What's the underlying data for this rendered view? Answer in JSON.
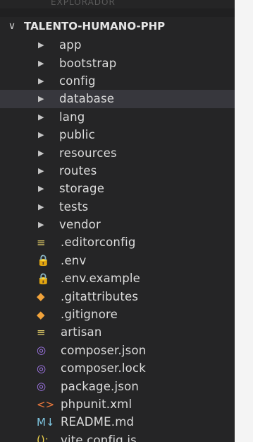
{
  "panel": {
    "header": "EXPLORADOR",
    "project": "TALENTO-HUMANO-PHP",
    "colors": {
      "background": "#252526",
      "selected": "#37373d",
      "text": "#dcdcdc"
    }
  },
  "tree": {
    "folders": [
      {
        "label": "app",
        "icon": "chevron-right-icon"
      },
      {
        "label": "bootstrap",
        "icon": "chevron-right-icon"
      },
      {
        "label": "config",
        "icon": "chevron-right-icon"
      },
      {
        "label": "database",
        "icon": "chevron-right-icon",
        "selected": true
      },
      {
        "label": "lang",
        "icon": "chevron-right-icon"
      },
      {
        "label": "public",
        "icon": "chevron-right-icon"
      },
      {
        "label": "resources",
        "icon": "chevron-right-icon"
      },
      {
        "label": "routes",
        "icon": "chevron-right-icon"
      },
      {
        "label": "storage",
        "icon": "chevron-right-icon"
      },
      {
        "label": "tests",
        "icon": "chevron-right-icon"
      },
      {
        "label": "vendor",
        "icon": "chevron-right-icon"
      }
    ],
    "files": [
      {
        "label": ".editorconfig",
        "icon": "lines-icon",
        "glyph": "≡",
        "color": "#e8d26a"
      },
      {
        "label": ".env",
        "icon": "lock-icon",
        "glyph": "🔒",
        "color": "#e8c14a"
      },
      {
        "label": ".env.example",
        "icon": "lock-icon",
        "glyph": "🔒",
        "color": "#e8c14a"
      },
      {
        "label": ".gitattributes",
        "icon": "git-icon",
        "glyph": "◆",
        "color": "#f1a33b"
      },
      {
        "label": ".gitignore",
        "icon": "git-icon",
        "glyph": "◆",
        "color": "#f1a33b"
      },
      {
        "label": "artisan",
        "icon": "lines-icon",
        "glyph": "≡",
        "color": "#e8d26a"
      },
      {
        "label": "composer.json",
        "icon": "composer-icon",
        "glyph": "◎",
        "color": "#a77bf3"
      },
      {
        "label": "composer.lock",
        "icon": "composer-icon",
        "glyph": "◎",
        "color": "#a77bf3"
      },
      {
        "label": "package.json",
        "icon": "composer-icon",
        "glyph": "◎",
        "color": "#a77bf3"
      },
      {
        "label": "phpunit.xml",
        "icon": "xml-icon",
        "glyph": "<>",
        "color": "#ef7a3c"
      },
      {
        "label": "README.md",
        "icon": "markdown-icon",
        "glyph": "M↓",
        "color": "#7ec5e0"
      },
      {
        "label": "vite.config.js",
        "icon": "js-config-icon",
        "glyph": "();",
        "color": "#f0d44d"
      }
    ]
  }
}
